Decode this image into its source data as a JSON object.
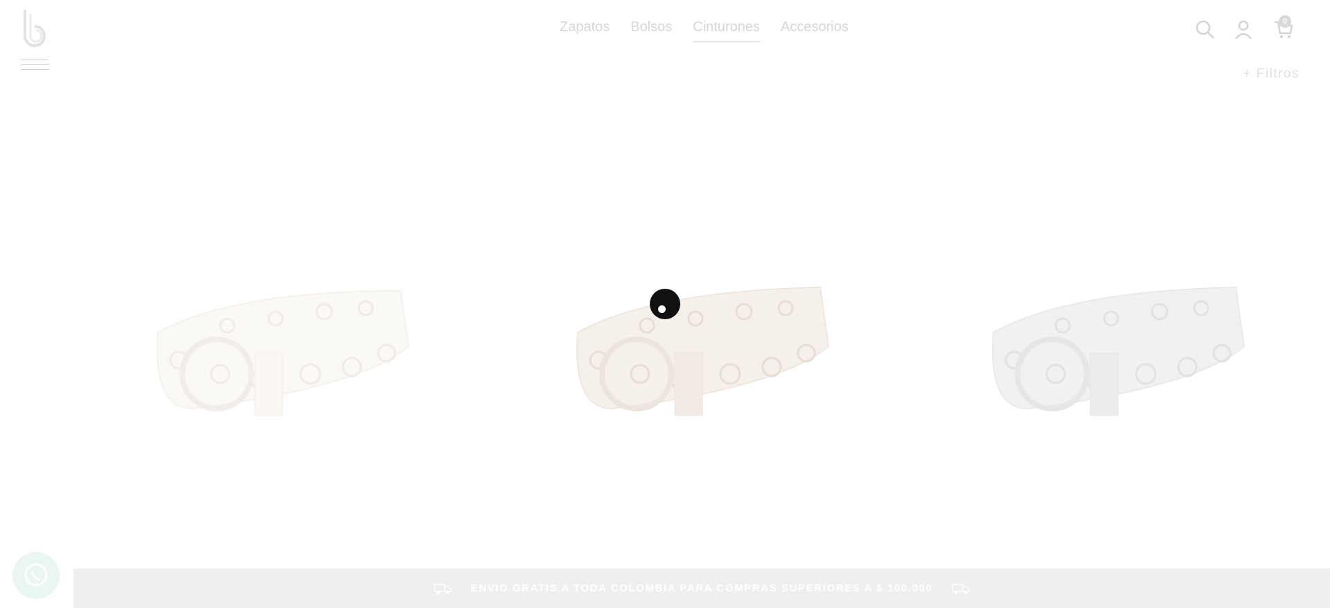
{
  "header": {
    "nav": [
      {
        "label": "Zapatos"
      },
      {
        "label": "Bolsos"
      },
      {
        "label": "Cinturones"
      },
      {
        "label": "Accesorios"
      }
    ],
    "active_nav": "Cinturones",
    "cart_count": "0",
    "filters_label": "+ Filtros"
  },
  "products": [
    {
      "image": "white-eyelet-belt",
      "color": "#fbf8f5"
    },
    {
      "image": "beige-eyelet-belt",
      "color": "#f4ede6"
    },
    {
      "image": "gray-eyelet-belt",
      "color": "#eeeeee"
    }
  ],
  "shipping_bar": {
    "text": "ENVIO GRATIS A TODA COLOMBIA PARA COMPRAS SUPERIORES A $ 100.000"
  },
  "icons": {
    "logo": "b-logo",
    "menu": "hamburger-icon",
    "search": "search-icon",
    "account": "user-icon",
    "cart": "cart-icon",
    "chat": "whatsapp-icon",
    "shipping": "truck-icon"
  },
  "colors": {
    "background": "#ffffff",
    "nav_text": "#d6d6d6",
    "shipping_bar_bg": "#efefef",
    "whatsapp_bg": "#e9f6f2",
    "loader": "#111111"
  }
}
